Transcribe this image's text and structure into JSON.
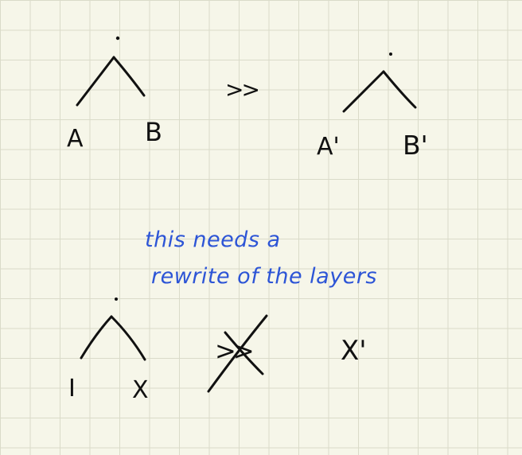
{
  "top_tree_left": {
    "left_leaf": "A",
    "right_leaf": "B"
  },
  "relation_symbol": ">>",
  "top_tree_right": {
    "left_leaf": "A'",
    "right_leaf": "B'"
  },
  "annotation": {
    "line1": "this needs a",
    "line2": "rewrite of the layers"
  },
  "bottom_tree": {
    "left_leaf": "I",
    "right_leaf": "X"
  },
  "crossed_relation_symbol": ">>",
  "bottom_result": "X'",
  "colors": {
    "ink": "#111111",
    "annotation": "#2d55d6",
    "grid": "#dadbc9",
    "paper": "#f6f6e9"
  }
}
